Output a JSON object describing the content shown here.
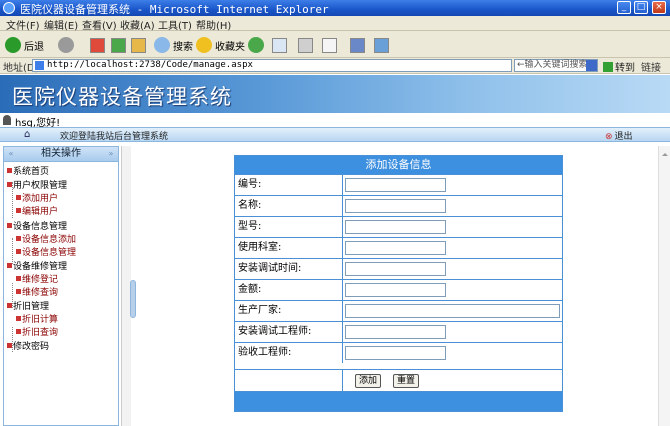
{
  "window": {
    "title": "医院仪器设备管理系统 - Microsoft Internet Explorer",
    "buttons": [
      "_",
      "□",
      "×"
    ]
  },
  "menu": [
    "文件(F)",
    "编辑(E)",
    "查看(V)",
    "收藏(A)",
    "工具(T)",
    "帮助(H)"
  ],
  "toolbar": {
    "back": "后退",
    "search": "搜索",
    "favorites": "收藏夹"
  },
  "address": {
    "label": "地址(D)",
    "url": "http://localhost:2738/Code/manage.aspx",
    "search_placeholder": "←输入关键词搜索",
    "go": "转到",
    "links": "链接"
  },
  "header": {
    "system_title": "医院仪器设备管理系统",
    "user_greeting": "hsg,您好!",
    "welcome": "欢迎登陆我站后台管理系统",
    "logout": "退出"
  },
  "sidebar": {
    "title": "相关操作",
    "items": [
      {
        "label": "系统首页",
        "level": 0
      },
      {
        "label": "用户权限管理",
        "level": 0
      },
      {
        "label": "添加用户",
        "level": 1
      },
      {
        "label": "编辑用户",
        "level": 1
      },
      {
        "label": "设备信息管理",
        "level": 0
      },
      {
        "label": "设备信息添加",
        "level": 1
      },
      {
        "label": "设备信息管理",
        "level": 1
      },
      {
        "label": "设备维修管理",
        "level": 0
      },
      {
        "label": "维修登记",
        "level": 1
      },
      {
        "label": "维修查询",
        "level": 1
      },
      {
        "label": "折旧管理",
        "level": 0
      },
      {
        "label": "折旧计算",
        "level": 1
      },
      {
        "label": "折旧查询",
        "level": 1
      },
      {
        "label": "修改密码",
        "level": 0
      }
    ]
  },
  "form": {
    "title": "添加设备信息",
    "fields": [
      {
        "label": "编号:",
        "value": ""
      },
      {
        "label": "名称:",
        "value": ""
      },
      {
        "label": "型号:",
        "value": ""
      },
      {
        "label": "使用科室:",
        "value": ""
      },
      {
        "label": "安装调试时间:",
        "value": ""
      },
      {
        "label": "金额:",
        "value": ""
      },
      {
        "label": "生产厂家:",
        "value": ""
      },
      {
        "label": "安装调试工程师:",
        "value": ""
      },
      {
        "label": "验收工程师:",
        "value": ""
      }
    ],
    "add_button": "添加",
    "reset_button": "重置"
  }
}
